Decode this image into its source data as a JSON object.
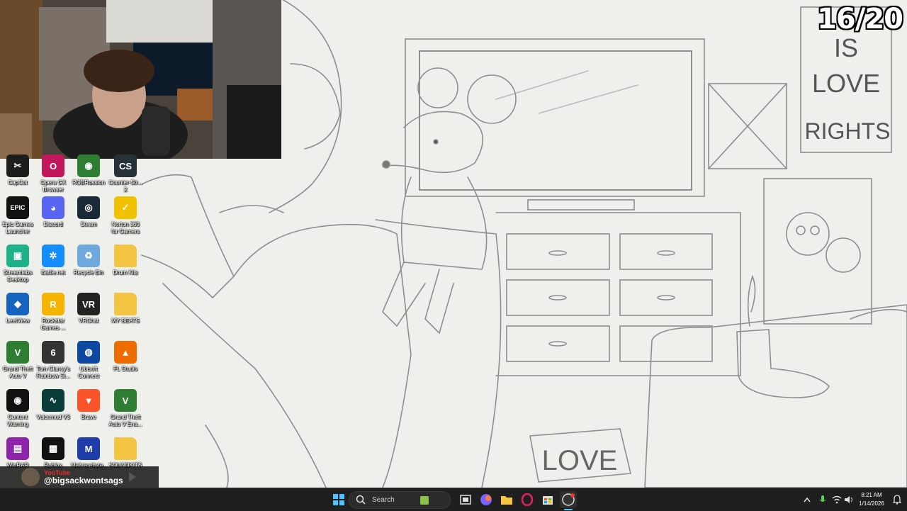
{
  "overlay": {
    "counter": "16/20",
    "youtube": {
      "label": "YouTube",
      "handle": "@bigsackwontsags"
    }
  },
  "wallpaper": {
    "poster_text": [
      "IS",
      "LOVE",
      "RIGHTS"
    ],
    "mat_text": "LOVE"
  },
  "desktop": {
    "icons": [
      {
        "label": "CapCut",
        "color": "#1d1d1d",
        "glyph": "✂"
      },
      {
        "label": "Opera GX Browser",
        "color": "#c2185b",
        "glyph": "O"
      },
      {
        "label": "ROBRussion",
        "color": "#2e7d32",
        "glyph": "◉"
      },
      {
        "label": "Counter-Str... 2",
        "color": "#263238",
        "glyph": "CS"
      },
      {
        "label": "Epic Games Launcher",
        "color": "#111111",
        "glyph": "EPIC"
      },
      {
        "label": "Discord",
        "color": "#5865f2",
        "glyph": "◕"
      },
      {
        "label": "Steam",
        "color": "#1b2838",
        "glyph": "◎"
      },
      {
        "label": "Norton 360 for Gamers",
        "color": "#f2c200",
        "glyph": "✓"
      },
      {
        "label": "Streamlabs Desktop",
        "color": "#1fb28a",
        "glyph": "▣"
      },
      {
        "label": "Battle.net",
        "color": "#148eff",
        "glyph": "✲"
      },
      {
        "label": "Recycle Bin",
        "color": "#6fa8dc",
        "glyph": "♻"
      },
      {
        "label": "Drum Kits",
        "color": "#f4c542",
        "glyph": ""
      },
      {
        "label": "LeetView",
        "color": "#1565c0",
        "glyph": "◆"
      },
      {
        "label": "Rockstar Games ...",
        "color": "#f4b400",
        "glyph": "R"
      },
      {
        "label": "VRChat",
        "color": "#222222",
        "glyph": "VR"
      },
      {
        "label": "MY BEATS",
        "color": "#f4c542",
        "glyph": ""
      },
      {
        "label": "Grand Theft Auto V",
        "color": "#2e7d32",
        "glyph": "V"
      },
      {
        "label": "Tom Clancy's Rainbow Si...",
        "color": "#333333",
        "glyph": "6"
      },
      {
        "label": "Ubisoft Connect",
        "color": "#0d47a1",
        "glyph": "◍"
      },
      {
        "label": "FL Studio",
        "color": "#ef6c00",
        "glyph": "▲"
      },
      {
        "label": "Content Warning",
        "color": "#111111",
        "glyph": "◉"
      },
      {
        "label": "Voicemod V3",
        "color": "#0b3d3a",
        "glyph": "∿"
      },
      {
        "label": "Brave",
        "color": "#fb542b",
        "glyph": "▼"
      },
      {
        "label": "Grand Theft Auto V Ena...",
        "color": "#2e7d32",
        "glyph": "V"
      },
      {
        "label": "WinRAR",
        "color": "#8e24aa",
        "glyph": "▤"
      },
      {
        "label": "Roblox",
        "color": "#111111",
        "glyph": "▩"
      },
      {
        "label": "Malwarebyte...",
        "color": "#1e3caa",
        "glyph": "M"
      },
      {
        "label": "SOUNDKITS",
        "color": "#f4c542",
        "glyph": ""
      }
    ]
  },
  "taskbar": {
    "search_placeholder": "Search",
    "time": "8:21 AM",
    "date": "1/14/2026"
  },
  "colors": {
    "taskbar": "#1f1f1f",
    "sketch_line": "#8a8a8a",
    "paper": "#efefec"
  }
}
